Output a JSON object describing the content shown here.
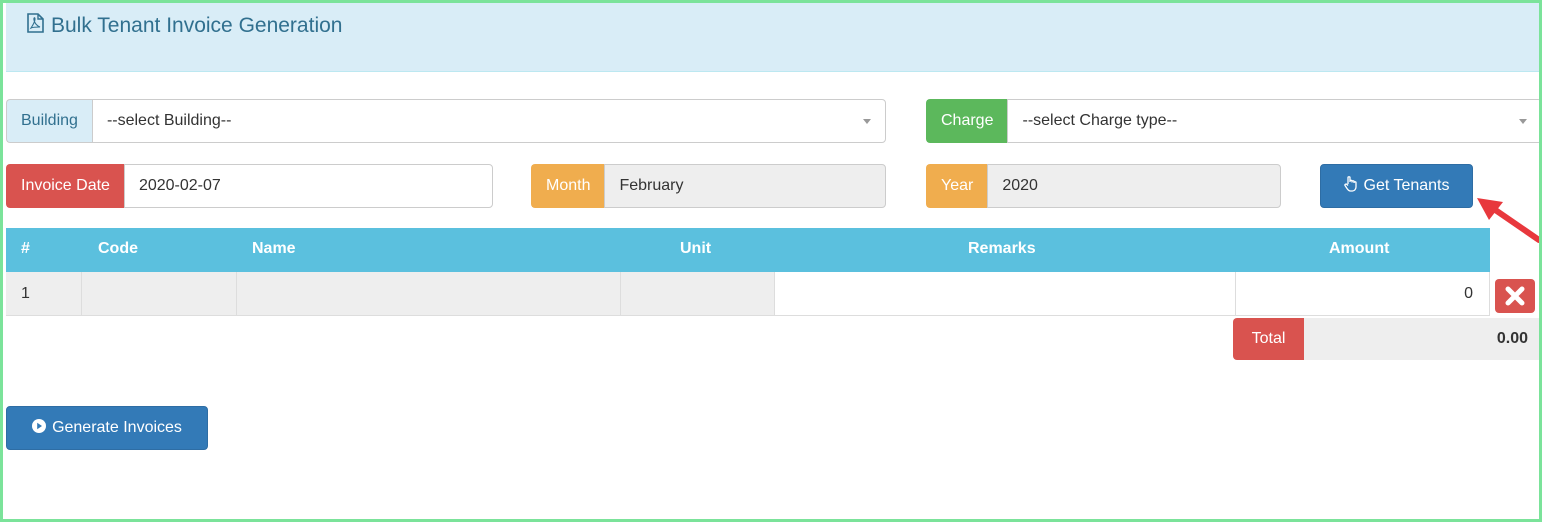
{
  "panel": {
    "title": "Bulk Tenant Invoice Generation",
    "icon": "file-pdf-icon"
  },
  "building": {
    "label": "Building",
    "value": "--select Building--"
  },
  "charge": {
    "label": "Charge",
    "value": "--select Charge type--"
  },
  "invoice_date": {
    "label": "Invoice Date",
    "value": "2020-02-07"
  },
  "month": {
    "label": "Month",
    "value": "February"
  },
  "year": {
    "label": "Year",
    "value": "2020"
  },
  "get_tenants": {
    "label": "Get Tenants",
    "icon": "hand-pointer-icon"
  },
  "table": {
    "headers": [
      "#",
      "Code",
      "Name",
      "Unit",
      "Remarks",
      "Amount"
    ],
    "rows": [
      {
        "num": "1",
        "code": "",
        "name": "",
        "unit": "",
        "remarks": "",
        "amount": "0"
      }
    ]
  },
  "total": {
    "label": "Total",
    "value": "0.00"
  },
  "generate": {
    "label": "Generate Invoices",
    "icon": "play-circle-icon"
  },
  "colors": {
    "primary": "#337ab7",
    "info": "#5bc0de",
    "danger": "#d9534f",
    "success": "#5cb85c",
    "warning": "#f0ad4e",
    "frame": "#7be39a",
    "annotation_arrow": "#e8383d"
  }
}
